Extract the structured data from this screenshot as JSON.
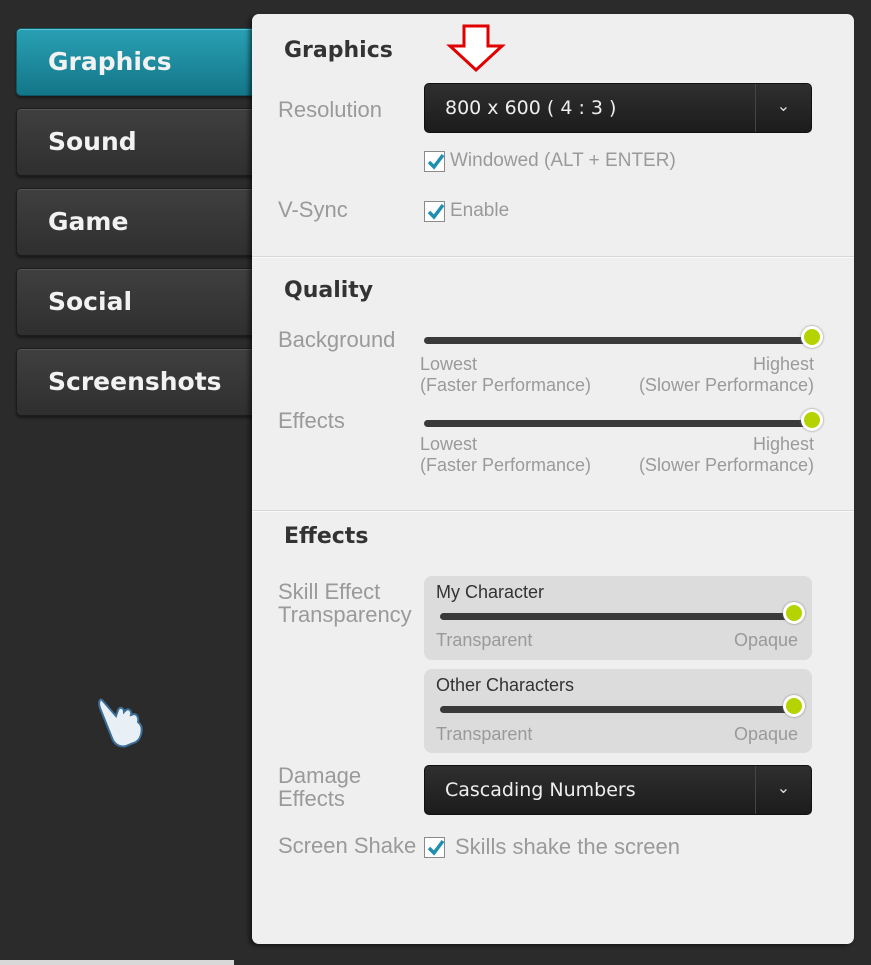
{
  "sidebar": {
    "items": [
      {
        "label": "Graphics",
        "active": true
      },
      {
        "label": "Sound",
        "active": false
      },
      {
        "label": "Game",
        "active": false
      },
      {
        "label": "Social",
        "active": false
      },
      {
        "label": "Screenshots",
        "active": false
      }
    ]
  },
  "graphics": {
    "title": "Graphics",
    "resolution_label": "Resolution",
    "resolution_value": "800 x 600 ( 4 : 3 )",
    "windowed_label": "Windowed (ALT + ENTER)",
    "windowed_checked": true,
    "vsync_label": "V-Sync",
    "vsync_enable_label": "Enable",
    "vsync_checked": true
  },
  "quality": {
    "title": "Quality",
    "background_label": "Background",
    "background_level": 1.0,
    "effects_label": "Effects",
    "effects_level": 1.0,
    "low_line1": "Lowest",
    "low_line2": "(Faster Performance)",
    "high_line1": "Highest",
    "high_line2": "(Slower Performance)"
  },
  "effects": {
    "title": "Effects",
    "skill_label_line1": "Skill Effect",
    "skill_label_line2": "Transparency",
    "my_character_label": "My Character",
    "my_character_level": 1.0,
    "other_characters_label": "Other Characters",
    "other_characters_level": 1.0,
    "transparent_label": "Transparent",
    "opaque_label": "Opaque",
    "damage_label_line1": "Damage",
    "damage_label_line2": "Effects",
    "damage_value": "Cascading Numbers",
    "shake_label": "Screen Shake",
    "shake_option_label": "Skills shake the screen",
    "shake_checked": true
  },
  "colors": {
    "accent": "#1a8ca0",
    "slider_knob": "#b4d300",
    "checkbox_mark": "#1e8fb0",
    "arrow": "#e00000"
  },
  "icons": {
    "dropdown": "chevron-down-icon",
    "checkbox": "checkmark-icon",
    "cursor": "pointing-hand-cursor-icon",
    "annotation": "red-down-arrow-icon"
  }
}
